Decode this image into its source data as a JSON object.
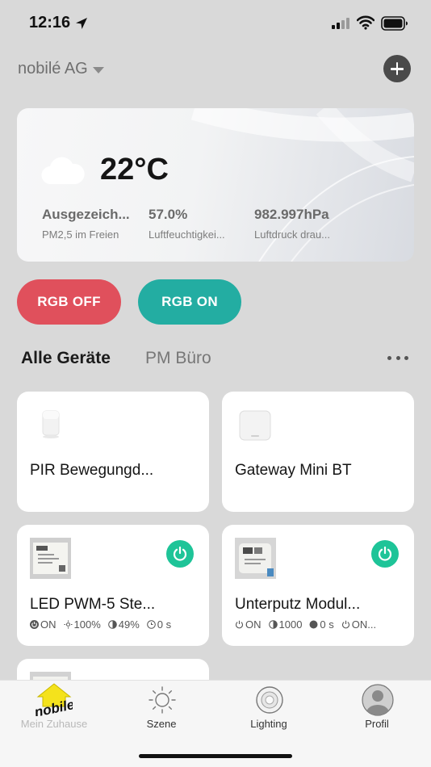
{
  "status_bar": {
    "time": "12:16"
  },
  "header": {
    "home_name": "nobilé AG"
  },
  "weather": {
    "temperature": "22°C",
    "stats": [
      {
        "value": "Ausgezeich...",
        "label": "PM2,5 im Freien"
      },
      {
        "value": "57.0%",
        "label": "Luftfeuchtigkei..."
      },
      {
        "value": "982.997hPa",
        "label": "Luftdruck drau..."
      }
    ]
  },
  "scenes": {
    "rgb_off": "RGB OFF",
    "rgb_on": "RGB ON"
  },
  "tabs": [
    {
      "label": "Alle Geräte"
    },
    {
      "label": "PM Büro"
    }
  ],
  "devices": [
    {
      "name": "PIR Bewegungd..."
    },
    {
      "name": "Gateway Mini BT"
    },
    {
      "name": "LED PWM-5 Ste...",
      "status": [
        "ON",
        "100%",
        "49%",
        "0 s"
      ]
    },
    {
      "name": "Unterputz Modul...",
      "status": [
        "ON",
        "1000",
        "0 s",
        "ON..."
      ]
    }
  ],
  "bottom_nav": [
    {
      "label": "Mein Zuhause",
      "logo_text": "nobile"
    },
    {
      "label": "Szene"
    },
    {
      "label": "Lighting"
    },
    {
      "label": "Profil"
    }
  ],
  "colors": {
    "rgb_off": "#e0505c",
    "rgb_on": "#23ada2",
    "power_on": "#1ec498"
  }
}
